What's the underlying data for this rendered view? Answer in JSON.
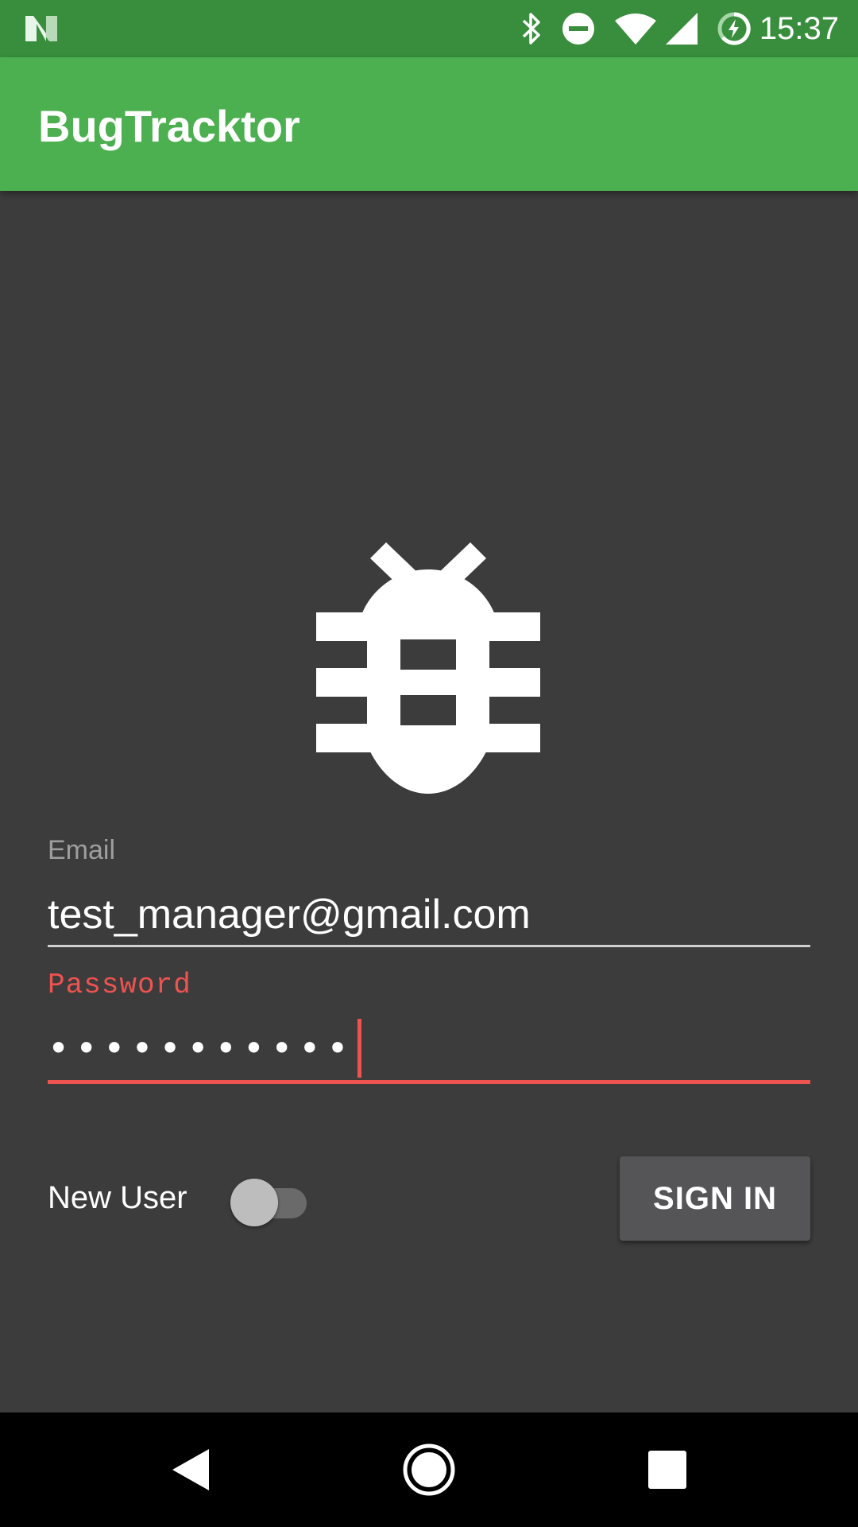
{
  "status_bar": {
    "time": "15:37",
    "icons": [
      "n-logo-icon",
      "bluetooth-icon",
      "do-not-disturb-icon",
      "wifi-icon",
      "cellular-signal-icon",
      "battery-charging-icon"
    ]
  },
  "app_bar": {
    "title": "BugTracktor"
  },
  "logo": {
    "icon": "bug-icon"
  },
  "form": {
    "email_label": "Email",
    "email_value": "test_manager@gmail.com",
    "password_label": "Password",
    "password_value_masked": "•••••••••••",
    "new_user_label": "New User",
    "new_user_toggle_on": false,
    "sign_in_label": "SIGN IN"
  },
  "nav_bar": {
    "buttons": [
      "back-icon",
      "home-icon",
      "recents-icon"
    ]
  },
  "colors": {
    "status_bar": "#388e3c",
    "app_bar": "#4caf50",
    "background": "#3c3c3c",
    "error_accent": "#ef5350",
    "button": "#555557"
  }
}
